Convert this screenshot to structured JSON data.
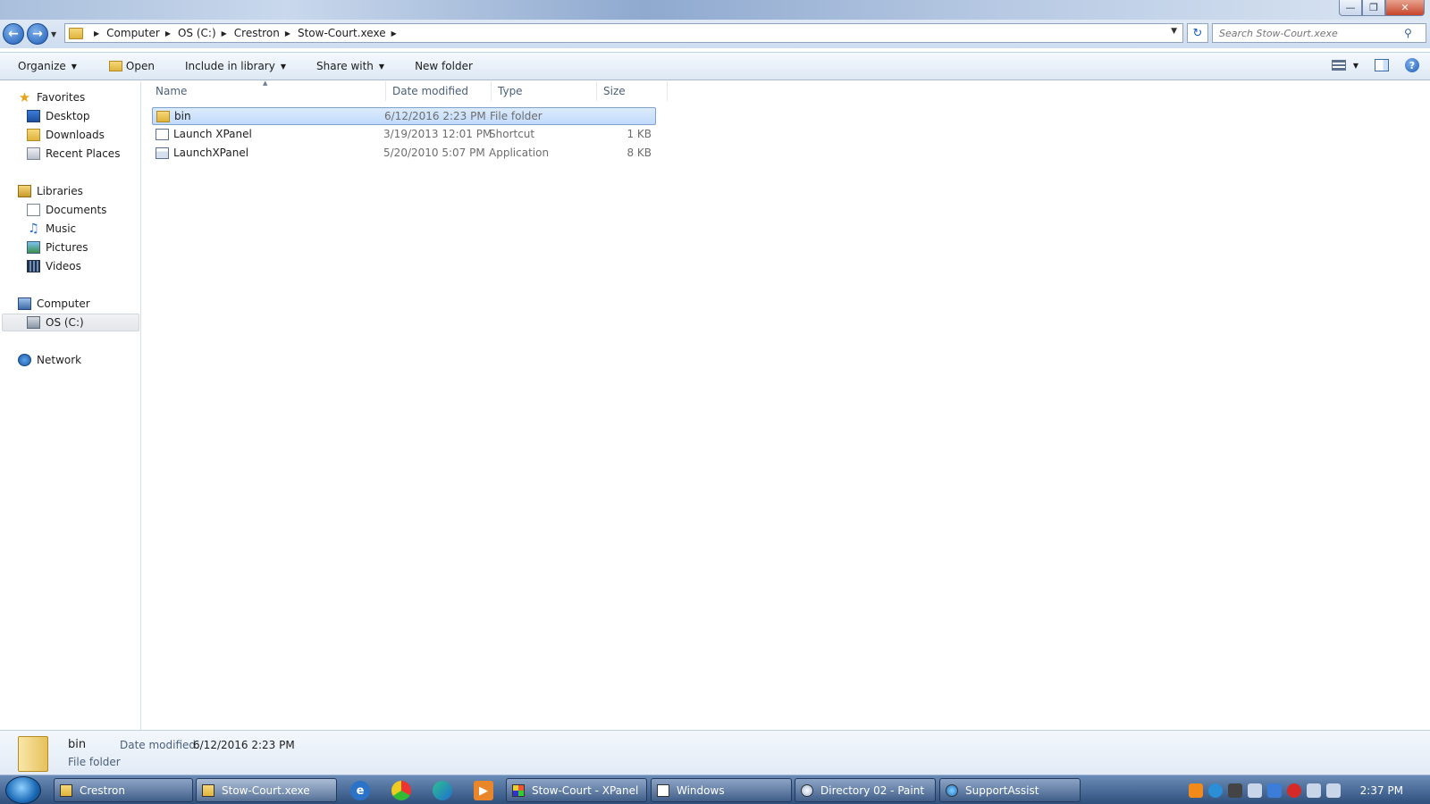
{
  "window": {
    "controls": {
      "minimize": "—",
      "maximize": "❐",
      "close": "✕"
    }
  },
  "address": {
    "breadcrumbs": [
      "Computer",
      "OS (C:)",
      "Crestron",
      "Stow-Court.xexe"
    ],
    "search_placeholder": "Search Stow-Court.xexe"
  },
  "toolbar": {
    "organize": "Organize",
    "open": "Open",
    "include_in_library": "Include in library",
    "share_with": "Share with",
    "new_folder": "New folder"
  },
  "nav": {
    "favorites": {
      "label": "Favorites",
      "items": [
        "Desktop",
        "Downloads",
        "Recent Places"
      ]
    },
    "libraries": {
      "label": "Libraries",
      "items": [
        "Documents",
        "Music",
        "Pictures",
        "Videos"
      ]
    },
    "computer": {
      "label": "Computer",
      "items": [
        "OS (C:)"
      ]
    },
    "network": {
      "label": "Network"
    }
  },
  "columns": {
    "name": "Name",
    "date": "Date modified",
    "type": "Type",
    "size": "Size"
  },
  "files": [
    {
      "name": "bin",
      "date": "6/12/2016 2:23 PM",
      "type": "File folder",
      "size": "",
      "icon": "folder-icon",
      "selected": true
    },
    {
      "name": "Launch XPanel",
      "date": "3/19/2013 12:01 PM",
      "type": "Shortcut",
      "size": "1 KB",
      "icon": "shortcut-icon",
      "selected": false
    },
    {
      "name": "LaunchXPanel",
      "date": "5/20/2010 5:07 PM",
      "type": "Application",
      "size": "8 KB",
      "icon": "application-icon",
      "selected": false
    }
  ],
  "details": {
    "name": "bin",
    "type": "File folder",
    "date_label": "Date modified:",
    "date_value": "6/12/2016 2:23 PM"
  },
  "taskbar": {
    "tasks": [
      "Crestron",
      "Stow-Court.xexe",
      "Stow-Court - XPanel",
      "Windows",
      "Directory 02 - Paint",
      "SupportAssist"
    ],
    "active_task": "Stow-Court.xexe",
    "clock": "2:37 PM"
  }
}
